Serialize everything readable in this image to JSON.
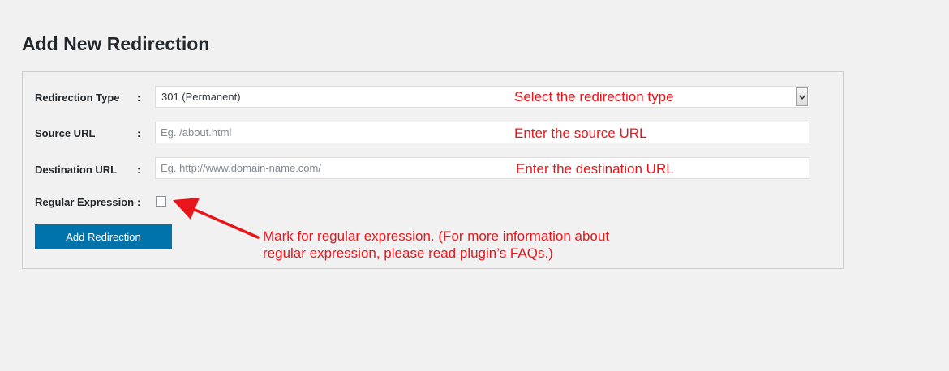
{
  "page": {
    "title": "Add New Redirection"
  },
  "form": {
    "redirection_type": {
      "label": "Redirection Type",
      "colon": ":",
      "selected": "301 (Permanent)"
    },
    "source_url": {
      "label": "Source URL",
      "colon": ":",
      "value": "",
      "placeholder": "Eg. /about.html"
    },
    "destination_url": {
      "label": "Destination URL",
      "colon": ":",
      "value": "",
      "placeholder": "Eg. http://www.domain-name.com/"
    },
    "regular_expression": {
      "label": "Regular Expression",
      "colon": ":",
      "checked": false
    },
    "submit_label": "Add Redirection"
  },
  "annotations": {
    "redirection_type": "Select the redirection type",
    "source_url": "Enter the source URL",
    "destination_url": "Enter the destination URL",
    "regex_line1": "Mark for regular expression. (For more information about",
    "regex_line2": "regular expression, please read plugin’s FAQs.)"
  },
  "colors": {
    "background": "#f1f1f1",
    "button": "#0073aa",
    "annotation": "#e8151b"
  },
  "icons": {
    "select_arrow": "chevron-down-icon",
    "annotation_arrow": "arrow-left-icon"
  }
}
